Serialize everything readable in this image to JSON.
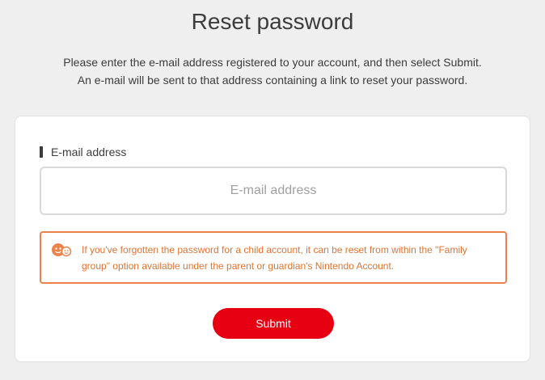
{
  "page": {
    "title": "Reset password",
    "intro_line_1": "Please enter the e-mail address registered to your account, and then select Submit.",
    "intro_line_2": "An e-mail will be sent to that address containing a link to reset your password."
  },
  "form": {
    "email_label": "E-mail address",
    "email_value": "",
    "email_placeholder": "E-mail address",
    "notice_icon": "family-icon",
    "notice_text": "If you've forgotten the password for a child account, it can be reset from within the \"Family group\" option available under the parent or guardian's Nintendo Account.",
    "submit_label": "Submit"
  },
  "colors": {
    "background": "#efefef",
    "accent": "#e60012",
    "notice": "#e9834a"
  }
}
